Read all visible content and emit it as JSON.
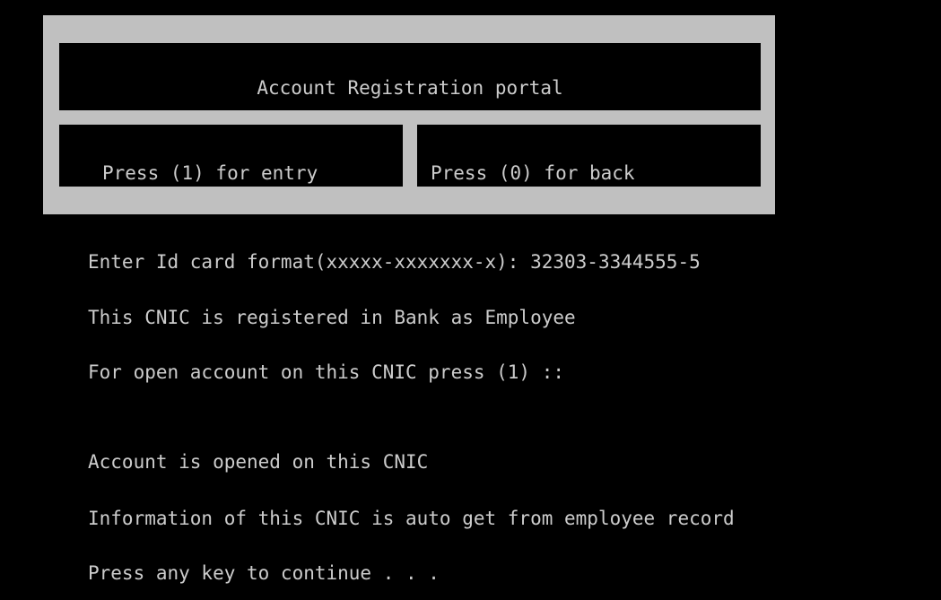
{
  "menu": {
    "title": "Account Registration portal",
    "option_entry": "Press (1) for entry",
    "option_back": "Press (0) for back"
  },
  "output": {
    "lines": [
      "Enter Id card format(xxxxx-xxxxxxx-x): 32303-3344555-5",
      "This CNIC is registered in Bank as Employee",
      "For open account on this CNIC press (1) ::",
      "Account is opened on this CNIC",
      "Information of this CNIC is auto get from employee record",
      "Press any key to continue . . ."
    ]
  },
  "colors": {
    "background": "#000000",
    "text": "#cccccc",
    "frame": "#c0c0c0"
  }
}
